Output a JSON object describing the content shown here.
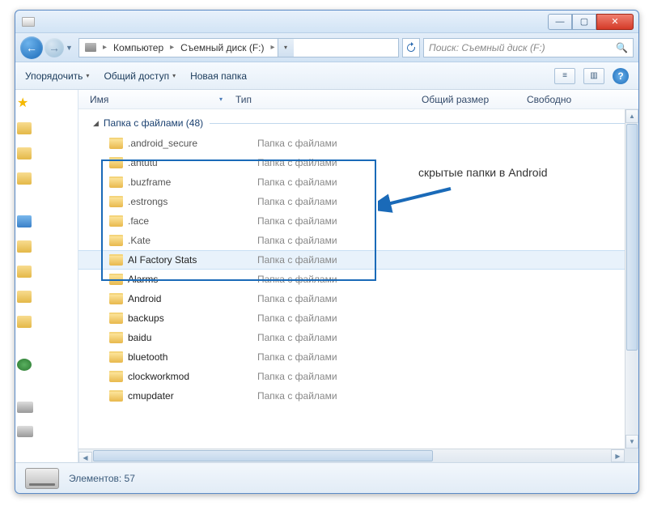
{
  "window": {
    "minimize": "—",
    "maximize": "▢",
    "close": "✕"
  },
  "nav": {
    "back": "←",
    "forward": "→",
    "dropdown": "▼",
    "breadcrumb": {
      "root_sep": "▸",
      "computer": "Компьютер",
      "drive": "Съемный диск (F:)",
      "sep": "▸",
      "dd": "▾"
    },
    "refresh": "↻",
    "search_placeholder": "Поиск: Съемный диск (F:)",
    "search_icon": "🔍"
  },
  "toolbar": {
    "organize": "Упорядочить",
    "share": "Общий доступ",
    "new_folder": "Новая папка",
    "dd": "▾",
    "view_icon": "≡",
    "preview_icon": "▥",
    "help": "?"
  },
  "columns": {
    "name": "Имя",
    "type": "Тип",
    "total_size": "Общий размер",
    "free": "Свободно"
  },
  "group": {
    "label": "Папка с файлами (48)",
    "tri": "◢"
  },
  "callout": {
    "text": "скрытые папки в Android"
  },
  "type_label": "Папка с файлами",
  "items": [
    {
      "name": ".android_secure",
      "hidden": true
    },
    {
      "name": ".antutu",
      "hidden": true
    },
    {
      "name": ".buzframe",
      "hidden": true
    },
    {
      "name": ".estrongs",
      "hidden": true
    },
    {
      "name": ".face",
      "hidden": true
    },
    {
      "name": ".Kate",
      "hidden": true
    },
    {
      "name": "AI Factory Stats",
      "hidden": false,
      "selected": true
    },
    {
      "name": "Alarms",
      "hidden": false
    },
    {
      "name": "Android",
      "hidden": false
    },
    {
      "name": "backups",
      "hidden": false
    },
    {
      "name": "baidu",
      "hidden": false
    },
    {
      "name": "bluetooth",
      "hidden": false
    },
    {
      "name": "clockworkmod",
      "hidden": false
    },
    {
      "name": "cmupdater",
      "hidden": false
    }
  ],
  "status": {
    "count": "Элементов: 57"
  }
}
